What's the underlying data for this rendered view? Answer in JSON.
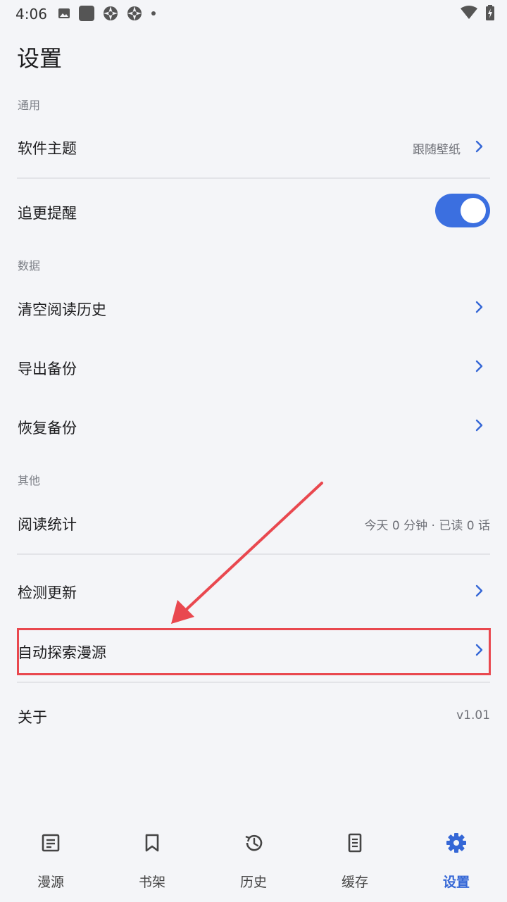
{
  "status_bar": {
    "time": "4:06"
  },
  "page": {
    "title": "设置"
  },
  "sections": {
    "general": "通用",
    "data": "数据",
    "other": "其他"
  },
  "rows": {
    "theme": {
      "label": "软件主题",
      "value": "跟随壁纸"
    },
    "update_reminder": {
      "label": "追更提醒",
      "toggle_on": true
    },
    "clear_history": {
      "label": "清空阅读历史"
    },
    "export_backup": {
      "label": "导出备份"
    },
    "restore_backup": {
      "label": "恢复备份"
    },
    "reading_stats": {
      "label": "阅读统计",
      "value": "今天 0 分钟 · 已读 0 话"
    },
    "check_update": {
      "label": "检测更新"
    },
    "auto_discover": {
      "label": "自动探索漫源"
    },
    "about": {
      "label": "关于",
      "value": "v1.01"
    }
  },
  "bottom_nav": [
    {
      "label": "漫源",
      "icon": "article-icon"
    },
    {
      "label": "书架",
      "icon": "bookmark-icon"
    },
    {
      "label": "历史",
      "icon": "history-icon"
    },
    {
      "label": "缓存",
      "icon": "document-icon"
    },
    {
      "label": "设置",
      "icon": "settings-gear-icon",
      "active": true
    }
  ],
  "colors": {
    "accent": "#3b6fe0",
    "highlight": "#e9484f",
    "background": "#f4f5f8"
  }
}
